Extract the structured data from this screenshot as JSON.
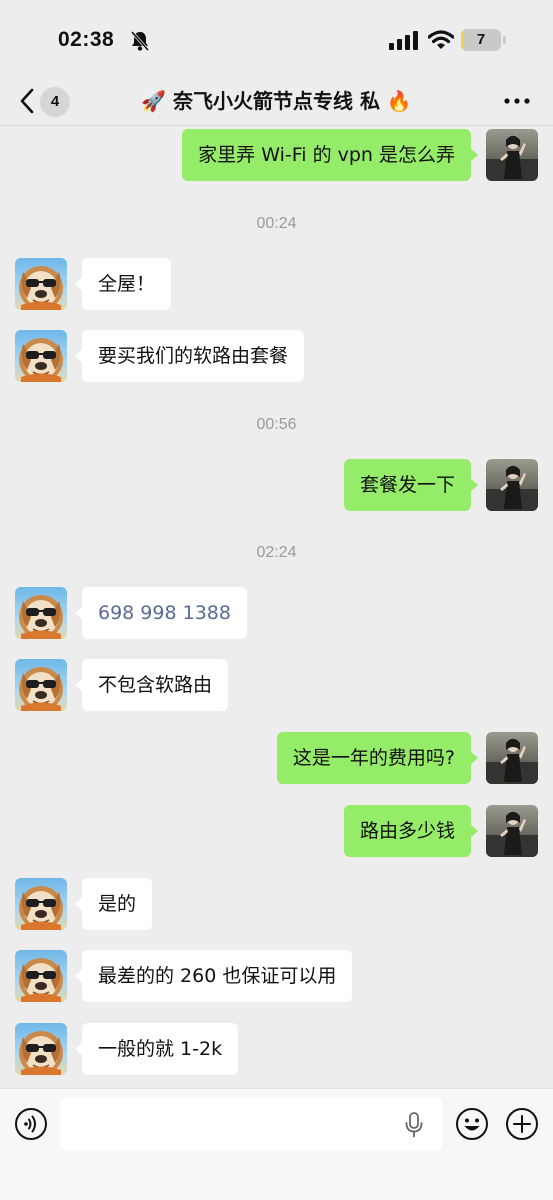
{
  "status_bar": {
    "time": "02:38",
    "battery_level": "7",
    "icons": [
      "bell-slash-icon",
      "signal-icon",
      "wifi-icon",
      "battery-icon"
    ],
    "battery_color": "#f3d04a"
  },
  "header": {
    "back_badge": "4",
    "title": "🚀 奈飞小火箭节点专线 私 🔥",
    "icons": [
      "chevron-left-icon",
      "more-icon"
    ]
  },
  "chat": {
    "messages": [
      {
        "side": "right",
        "text": "家里弄 Wi-Fi 的 vpn 是怎么弄"
      },
      {
        "timestamp": "00:24"
      },
      {
        "side": "left",
        "text": "全屋！"
      },
      {
        "side": "left",
        "text": "要买我们的软路由套餐"
      },
      {
        "timestamp": "00:56"
      },
      {
        "side": "right",
        "text": "套餐发一下"
      },
      {
        "timestamp": "02:24"
      },
      {
        "side": "left",
        "text": "698 998 1388",
        "link": true
      },
      {
        "side": "left",
        "text": "不包含软路由"
      },
      {
        "side": "right",
        "text": "这是一年的费用吗?"
      },
      {
        "side": "right",
        "text": "路由多少钱"
      },
      {
        "side": "left",
        "text": "是的"
      },
      {
        "side": "left",
        "text": "最差的的 260 也保证可以用"
      },
      {
        "side": "left",
        "text": "一般的就 1-2k"
      }
    ]
  },
  "input_bar": {
    "placeholder": "",
    "icons": [
      "voice-icon",
      "mic-icon",
      "emoji-icon",
      "plus-icon"
    ]
  },
  "colors": {
    "background": "#ededed",
    "outgoing_bubble": "#95ec69",
    "incoming_bubble": "#ffffff",
    "link": "#576b95"
  }
}
